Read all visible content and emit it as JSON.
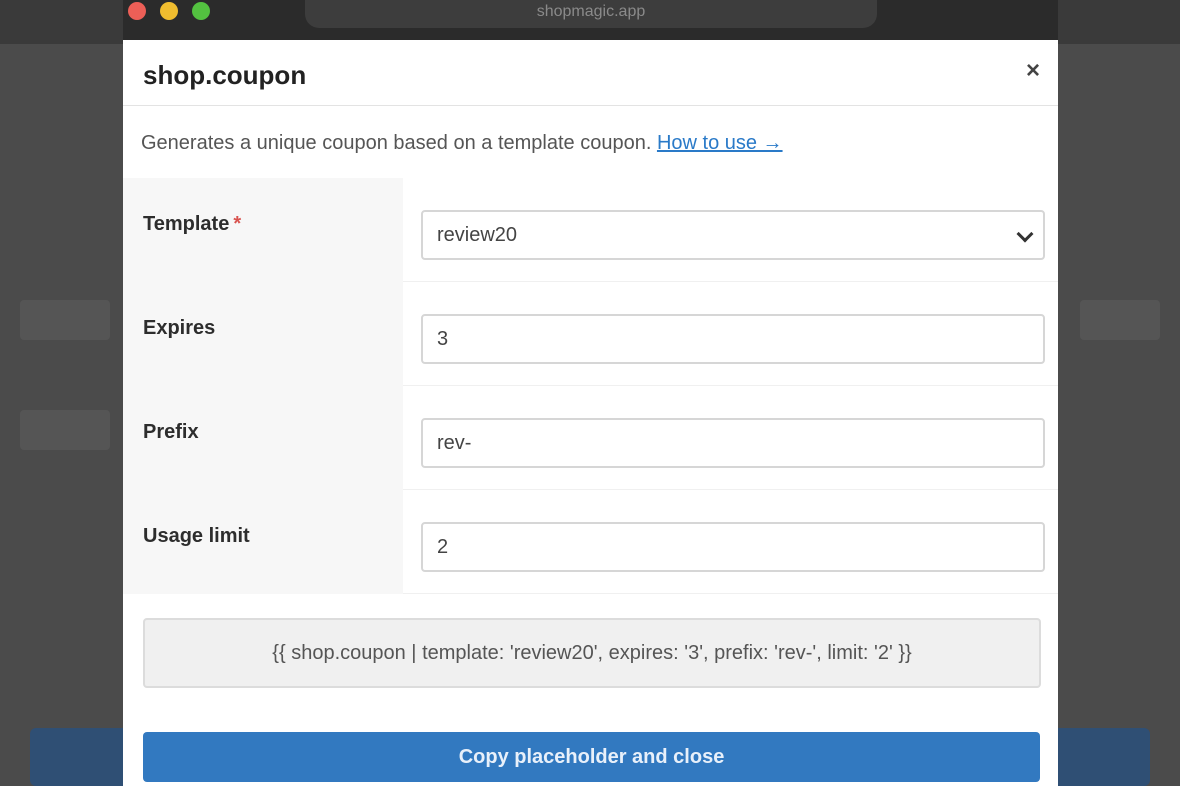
{
  "window": {
    "url": "shopmagic.app"
  },
  "modal": {
    "title": "shop.coupon",
    "close_label": "×",
    "description": "Generates a unique coupon based on a template coupon.",
    "help_link": "How to use →"
  },
  "form": {
    "template": {
      "label": "Template",
      "required_mark": "*",
      "value": "review20"
    },
    "expires": {
      "label": "Expires",
      "value": "3"
    },
    "prefix": {
      "label": "Prefix",
      "value": "rev-"
    },
    "usage_limit": {
      "label": "Usage limit",
      "value": "2"
    }
  },
  "placeholder_text": "{{ shop.coupon | template: 'review20', expires: '3', prefix: 'rev-', limit: '2' }}",
  "actions": {
    "primary_label": "Copy placeholder and close"
  },
  "colors": {
    "accent": "#3279c0",
    "link": "#2a7ac8",
    "required": "#d9534f"
  },
  "icons": {
    "close": "close-icon",
    "select": "chevron-down-icon"
  }
}
